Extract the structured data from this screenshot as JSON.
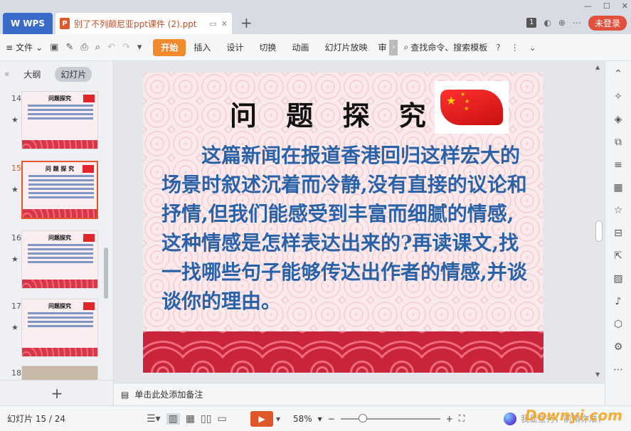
{
  "titlebar": {
    "app_tab": "WPS",
    "doc_tab_title": "别了不列颠尼亚ppt课件 (2).ppt",
    "page_badge": "1",
    "login_label": "未登录"
  },
  "ribbon": {
    "file_menu": "文件",
    "tabs": [
      "开始",
      "插入",
      "设计",
      "切换",
      "动画",
      "幻灯片放映",
      "审"
    ],
    "search_label": "查找命令、搜索模板"
  },
  "leftpanel": {
    "tabs": [
      "大纲",
      "幻灯片"
    ],
    "thumbs": [
      {
        "num": "14",
        "title": "问题探究"
      },
      {
        "num": "15",
        "title": "问 题 探 究"
      },
      {
        "num": "16",
        "title": "问题探究"
      },
      {
        "num": "17",
        "title": "问题探究"
      },
      {
        "num": "18",
        "title": ""
      }
    ]
  },
  "slide": {
    "title": "问 题 探 究",
    "body": "这篇新闻在报道香港回归这样宏大的场景时叙述沉着而冷静,没有直接的议论和抒情,但我们能感受到丰富而细腻的情感,这种情感是怎样表达出来的?再读课文,找一找哪些句子能够传达出作者的情感,并谈谈你的理由。"
  },
  "notes": {
    "placeholder": "单击此处添加备注"
  },
  "statusbar": {
    "slide_info": "幻灯片 15 / 24",
    "zoom": "58%",
    "zoom_level": 0.22,
    "brand_text": "我显堂行，前精你准，"
  },
  "watermark": "Downyi.com",
  "colors": {
    "accent": "#f08a2c",
    "body_text": "#2a62a8",
    "wps_blue": "#3a6bc8",
    "login_red": "#e0503b"
  }
}
